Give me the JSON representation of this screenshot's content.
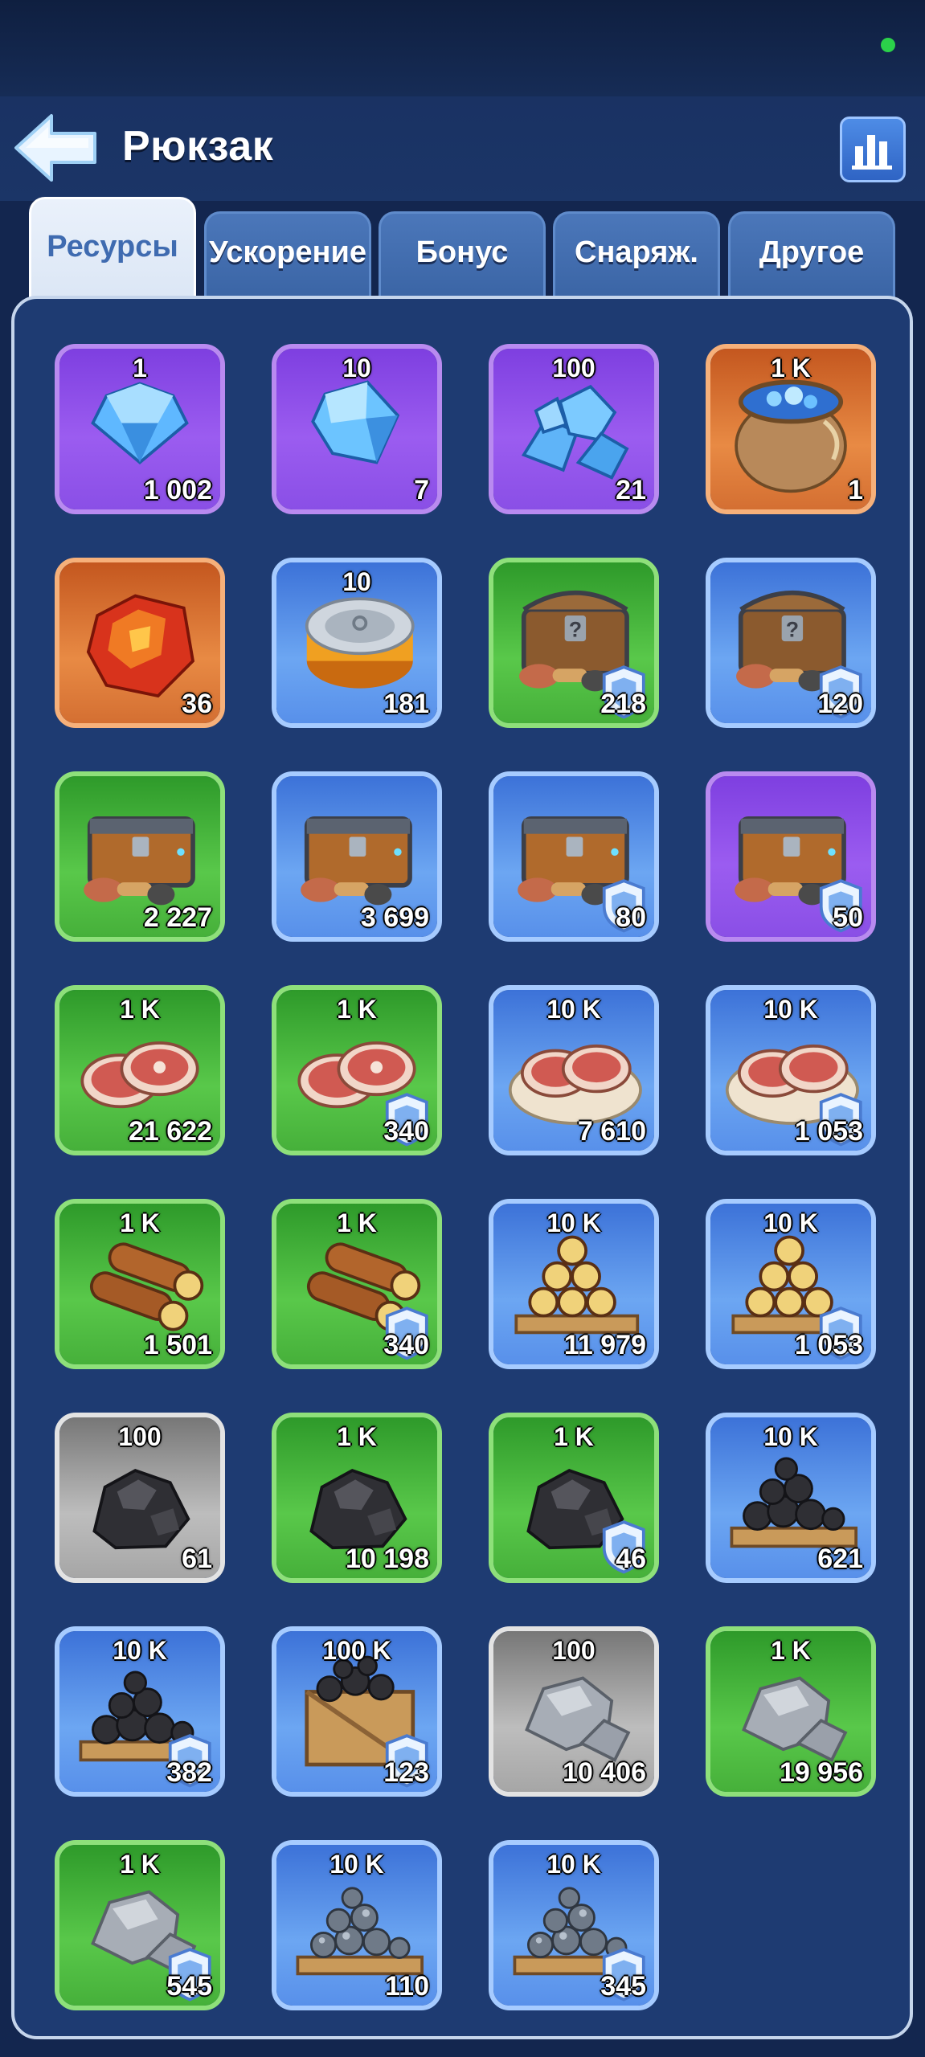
{
  "header": {
    "title": "Рюкзак",
    "back_icon": "back-arrow-icon",
    "stats_icon": "bar-chart-icon"
  },
  "tabs": [
    {
      "label": "Ресурсы",
      "active": true
    },
    {
      "label": "Ускорение",
      "active": false
    },
    {
      "label": "Бонус",
      "active": false
    },
    {
      "label": "Снаряж.",
      "active": false
    },
    {
      "label": "Другое",
      "active": false
    }
  ],
  "colors": {
    "purple": "#8a4fe6",
    "orange": "#d46f32",
    "blue": "#5890ea",
    "green": "#46b03a",
    "gray": "#a6a6a6",
    "status_dot": "#2bd14a"
  },
  "items": [
    {
      "icon": "gem-icon",
      "rarity": "purple",
      "pack": "1",
      "count": "1 002",
      "shield": false
    },
    {
      "icon": "gems-icon",
      "rarity": "purple",
      "pack": "10",
      "count": "7",
      "shield": false
    },
    {
      "icon": "gem-pile-icon",
      "rarity": "purple",
      "pack": "100",
      "count": "21",
      "shield": false
    },
    {
      "icon": "gem-sack-icon",
      "rarity": "orange",
      "pack": "1 K",
      "count": "1",
      "shield": false
    },
    {
      "icon": "red-crystal-icon",
      "rarity": "orange",
      "pack": "",
      "count": "36",
      "shield": false
    },
    {
      "icon": "canned-food-icon",
      "rarity": "blue",
      "pack": "10",
      "count": "181",
      "shield": false
    },
    {
      "icon": "mystery-chest-icon",
      "rarity": "green",
      "pack": "",
      "count": "218",
      "shield": true
    },
    {
      "icon": "mystery-chest-icon",
      "rarity": "blue",
      "pack": "",
      "count": "120",
      "shield": true
    },
    {
      "icon": "resource-chest-icon",
      "rarity": "green",
      "pack": "",
      "count": "2 227",
      "shield": false
    },
    {
      "icon": "resource-chest-icon",
      "rarity": "blue",
      "pack": "",
      "count": "3 699",
      "shield": false
    },
    {
      "icon": "resource-chest-icon",
      "rarity": "blue",
      "pack": "",
      "count": "80",
      "shield": true
    },
    {
      "icon": "resource-chest-icon",
      "rarity": "purple",
      "pack": "",
      "count": "50",
      "shield": true
    },
    {
      "icon": "meat-icon",
      "rarity": "green",
      "pack": "1 K",
      "count": "21 622",
      "shield": false
    },
    {
      "icon": "meat-icon",
      "rarity": "green",
      "pack": "1 K",
      "count": "340",
      "shield": true
    },
    {
      "icon": "meat-plate-icon",
      "rarity": "blue",
      "pack": "10 K",
      "count": "7 610",
      "shield": false
    },
    {
      "icon": "meat-plate-icon",
      "rarity": "blue",
      "pack": "10 K",
      "count": "1 053",
      "shield": true
    },
    {
      "icon": "wood-logs-icon",
      "rarity": "green",
      "pack": "1 K",
      "count": "1 501",
      "shield": false
    },
    {
      "icon": "wood-logs-icon",
      "rarity": "green",
      "pack": "1 K",
      "count": "340",
      "shield": true
    },
    {
      "icon": "wood-pallet-icon",
      "rarity": "blue",
      "pack": "10 K",
      "count": "11 979",
      "shield": false
    },
    {
      "icon": "wood-pallet-icon",
      "rarity": "blue",
      "pack": "10 K",
      "count": "1 053",
      "shield": true
    },
    {
      "icon": "coal-icon",
      "rarity": "gray",
      "pack": "100",
      "count": "61",
      "shield": false
    },
    {
      "icon": "coal-icon",
      "rarity": "green",
      "pack": "1 K",
      "count": "10 198",
      "shield": false
    },
    {
      "icon": "coal-icon",
      "rarity": "green",
      "pack": "1 K",
      "count": "46",
      "shield": true
    },
    {
      "icon": "coal-pallet-icon",
      "rarity": "blue",
      "pack": "10 K",
      "count": "621",
      "shield": false
    },
    {
      "icon": "coal-pallet-icon",
      "rarity": "blue",
      "pack": "10 K",
      "count": "382",
      "shield": true
    },
    {
      "icon": "coal-crate-icon",
      "rarity": "blue",
      "pack": "100 K",
      "count": "123",
      "shield": true
    },
    {
      "icon": "stone-icon",
      "rarity": "gray",
      "pack": "100",
      "count": "10 406",
      "shield": false
    },
    {
      "icon": "stone-icon",
      "rarity": "green",
      "pack": "1 K",
      "count": "19 956",
      "shield": false
    },
    {
      "icon": "stone-icon",
      "rarity": "green",
      "pack": "1 K",
      "count": "545",
      "shield": true
    },
    {
      "icon": "iron-ore-pallet-icon",
      "rarity": "blue",
      "pack": "10 K",
      "count": "110",
      "shield": false
    },
    {
      "icon": "iron-ore-pallet-icon",
      "rarity": "blue",
      "pack": "10 K",
      "count": "345",
      "shield": true
    }
  ]
}
